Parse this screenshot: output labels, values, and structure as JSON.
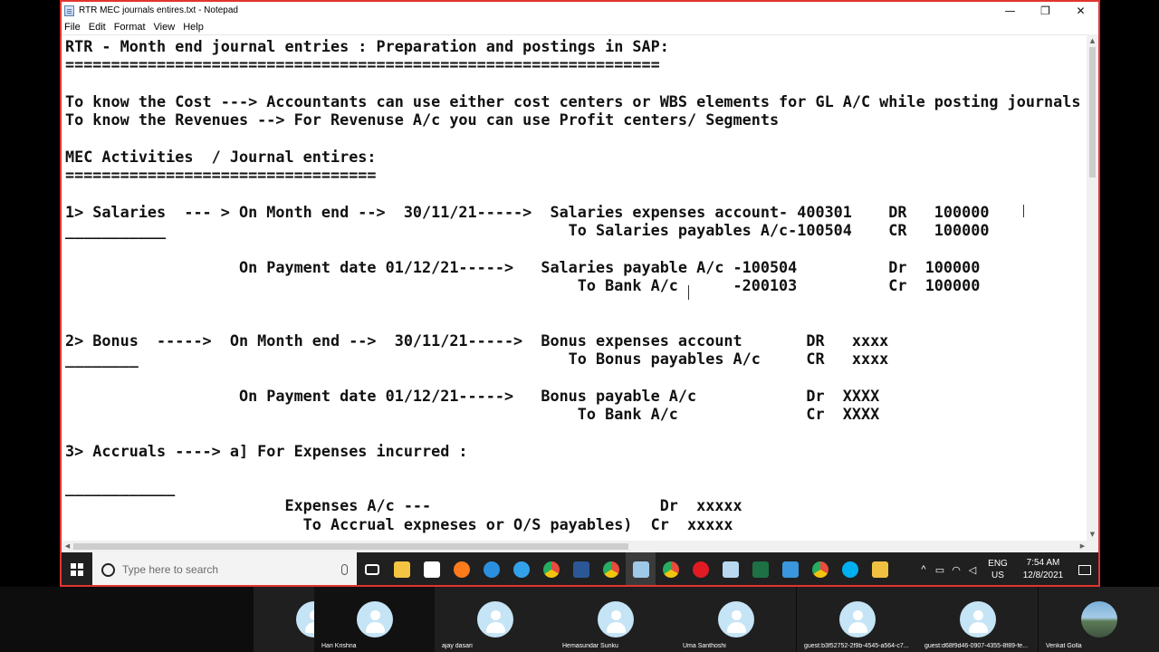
{
  "window": {
    "title": "RTR MEC journals entires.txt - Notepad",
    "minimize": "—",
    "maximize": "❐",
    "close": "✕"
  },
  "menu": [
    "File",
    "Edit",
    "Format",
    "View",
    "Help"
  ],
  "editor_lines": [
    "RTR - Month end journal entries : Preparation and postings in SAP:",
    "=================================================================",
    "",
    "To know the Cost ---> Accountants can use either cost centers or WBS elements for GL A/C while posting journals",
    "To know the Revenues --> For Revenuse A/c you can use Profit centers/ Segments",
    "",
    "MEC Activities  / Journal entires:",
    "==================================",
    "",
    "1> Salaries  --- > On Month end -->  30/11/21----->  Salaries expenses account- 400301    DR   100000",
    "___________                                            To Salaries payables A/c-100504    CR   100000",
    "",
    "                   On Payment date 01/12/21----->   Salaries payable A/c -100504          Dr  100000",
    "                                                        To Bank A/c      -200103          Cr  100000",
    "",
    "",
    "2> Bonus  ----->  On Month end -->  30/11/21----->  Bonus expenses account       DR   xxxx",
    "________                                               To Bonus payables A/c     CR   xxxx",
    "",
    "                   On Payment date 01/12/21----->   Bonus payable A/c            Dr  XXXX",
    "                                                        To Bank A/c              Cr  XXXX",
    "",
    "3> Accruals ----> a] For Expenses incurred :",
    "",
    "____________",
    "                        Expenses A/c ---                         Dr  xxxxx",
    "                          To Accrual expneses or O/S payables)  Cr  xxxxx"
  ],
  "taskbar": {
    "search_placeholder": "Type here to search",
    "apps": [
      "task-view",
      "file-explorer",
      "store",
      "firefox",
      "edge",
      "ie",
      "chrome",
      "word",
      "chrome-profile",
      "notepad",
      "chrome-2",
      "opera",
      "notepad-2",
      "excel",
      "remote",
      "chrome-3",
      "skype",
      "files"
    ],
    "tray": {
      "lang_top": "ENG",
      "lang_bottom": "US",
      "time": "7:54 AM",
      "date": "12/8/2021"
    }
  },
  "participants": [
    {
      "name": ""
    },
    {
      "name": "Hari Krishna"
    },
    {
      "name": "ajay dasari"
    },
    {
      "name": "Hemasundar Sunku"
    },
    {
      "name": "Uma Santhoshi"
    },
    {
      "name": "guest:b3f52752-2f9b-4545-a564-c7..."
    },
    {
      "name": "guest:d68f9d46-0907-4355-8f89-fe..."
    },
    {
      "name": "Venkat Golla"
    }
  ],
  "colors": {
    "frame_border": "#e3342f",
    "taskbar": "#202020",
    "participant_bg": "#1f1f1f"
  }
}
